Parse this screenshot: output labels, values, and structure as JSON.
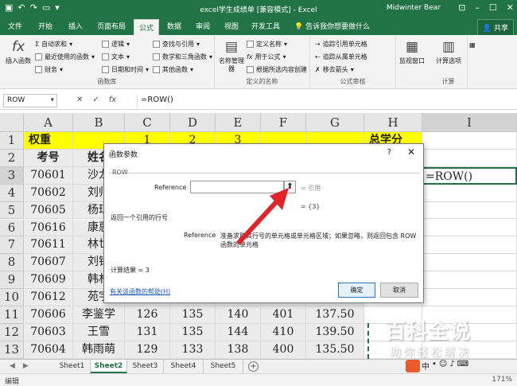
{
  "title_bar": {
    "title": "excel学生成绩单 [兼容模式] - Excel",
    "user": "Midwinter Bear"
  },
  "tabs": [
    "文件",
    "开始",
    "插入",
    "页面布局",
    "公式",
    "数据",
    "审阅",
    "视图",
    "开发工具"
  ],
  "active_tab": "公式",
  "tell_me": "告诉我你想要做什么",
  "share_label": "共享",
  "ribbon": {
    "insert_function": "插入函数",
    "library_items": [
      "自动求和",
      "最近使用的函数",
      "财务",
      "逻辑",
      "文本",
      "日期和时间",
      "查找与引用",
      "数学和三角函数",
      "其他函数"
    ],
    "library_label": "函数库",
    "name_manager": "名称管理器",
    "defined_items": [
      "定义名称",
      "用于公式",
      "根据所选内容创建"
    ],
    "defined_label": "定义的名称",
    "audit_items": [
      "追踪引用单元格",
      "追踪从属单元格",
      "移去箭头"
    ],
    "audit_label": "公式审核",
    "watch_window": "监视窗口",
    "calc_options": "计算选项",
    "calc_label": "计算"
  },
  "formula_bar": {
    "name_box": "ROW",
    "formula": "=ROW()"
  },
  "columns": [
    "A",
    "B",
    "C",
    "D",
    "E",
    "F",
    "G",
    "H",
    "I"
  ],
  "rows": [
    "1",
    "2",
    "3",
    "4",
    "5",
    "6",
    "7",
    "8",
    "9",
    "10",
    "11",
    "12",
    "13"
  ],
  "grid": {
    "r1": {
      "a": "权重",
      "c": "1",
      "d": "2",
      "e": "3",
      "h": "总学分"
    },
    "r2": {
      "a": "考号",
      "b": "姓名"
    },
    "active_cell": "=ROW()",
    "data_rows": [
      {
        "a": "70601",
        "b": "沙龙"
      },
      {
        "a": "70602",
        "b": "刘帅"
      },
      {
        "a": "70605",
        "b": "杨琼"
      },
      {
        "a": "70616",
        "b": "康惠"
      },
      {
        "a": "70611",
        "b": "林世"
      },
      {
        "a": "70607",
        "b": "刘钰"
      },
      {
        "a": "70609",
        "b": "韩林"
      },
      {
        "a": "70612",
        "b": "苑宇"
      },
      {
        "a": "70606",
        "b": "李鉴学",
        "c": "126",
        "d": "135",
        "e": "140",
        "f": "401",
        "g": "137.50"
      },
      {
        "a": "70603",
        "b": "王雪",
        "c": "131",
        "d": "135",
        "e": "144",
        "f": "410",
        "g": "139.50"
      },
      {
        "a": "70604",
        "b": "韩雨萌",
        "c": "129",
        "d": "133",
        "e": "138",
        "f": "400",
        "g": "135.50"
      }
    ]
  },
  "sheets": [
    "Sheet1",
    "Sheet2",
    "Sheet3",
    "Sheet4",
    "Sheet5"
  ],
  "active_sheet": "Sheet2",
  "status_mode": "编辑",
  "zoom": "171%",
  "dialog": {
    "title": "函数参数",
    "help": "?",
    "function_name": "ROW",
    "arg_label": "Reference",
    "arg_value": "",
    "arg_type": "= 引用",
    "arg_result": "= {3}",
    "description": "返回一个引用的行号",
    "arg_name": "Reference",
    "arg_description": "准备求取其行号的单元格或单元格区域；如果忽略，则返回包含 ROW 函数的单元格",
    "calc_result": "计算结果 = 3",
    "help_link": "有关该函数的帮助(H)",
    "ok": "确定",
    "cancel": "取消"
  },
  "watermark": {
    "name": "百科全说",
    "slogan": "助你轻松解决"
  },
  "colors": {
    "excel_green": "#217346",
    "highlight_yellow": "#ffff00",
    "arrow_red": "#e0242b"
  }
}
